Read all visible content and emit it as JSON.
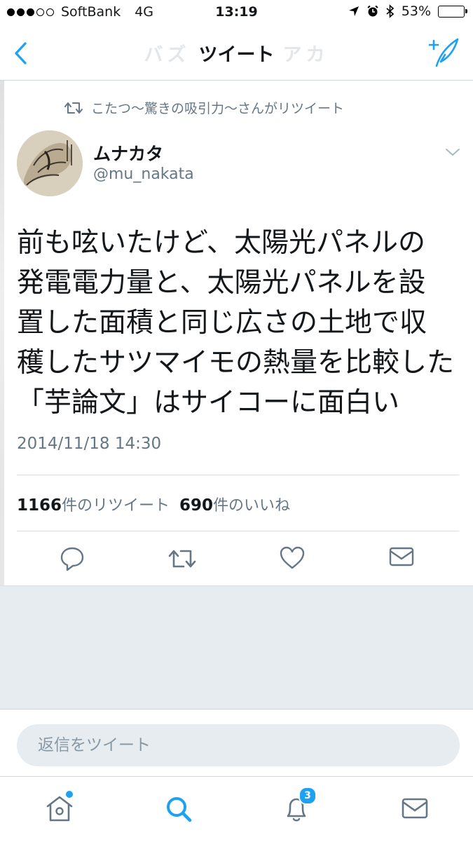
{
  "status_bar": {
    "carrier": "SoftBank",
    "network": "4G",
    "time": "13:19",
    "battery": "53%",
    "battery_level": 0.53
  },
  "nav": {
    "title": "ツイート",
    "ghost_title": "バズ　　　　アカ"
  },
  "retweet_context": "こたつ〜驚きの吸引力〜さんがリツイート",
  "tweet": {
    "display_name": "ムナカタ",
    "handle": "@mu_nakata",
    "text_lines": [
      "前も呟いたけど、太陽光パネルの",
      "発電電力量と、太陽光パネルを設",
      "置した面積と同じ広さの土地で収",
      "穫したサツマイモの熱量を比較した",
      "「芋論文」はサイコーに面白い"
    ],
    "timestamp": "2014/11/18 14:30",
    "retweet_count": "1166",
    "retweet_suffix": "件のリツイート",
    "like_count": "690",
    "like_suffix": "件のいいね"
  },
  "reply": {
    "placeholder": "返信をツイート"
  },
  "tabbar": {
    "notifications_badge": "3"
  },
  "colors": {
    "accent": "#1da1f2",
    "muted": "#657786",
    "bg_grey": "#e6ecf0"
  },
  "icons": [
    "back-icon",
    "compose-icon",
    "retweet-icon",
    "caret-down-icon",
    "reply-icon",
    "retweet-action-icon",
    "like-icon",
    "message-icon",
    "home-icon",
    "search-icon",
    "notifications-icon",
    "messages-icon"
  ]
}
